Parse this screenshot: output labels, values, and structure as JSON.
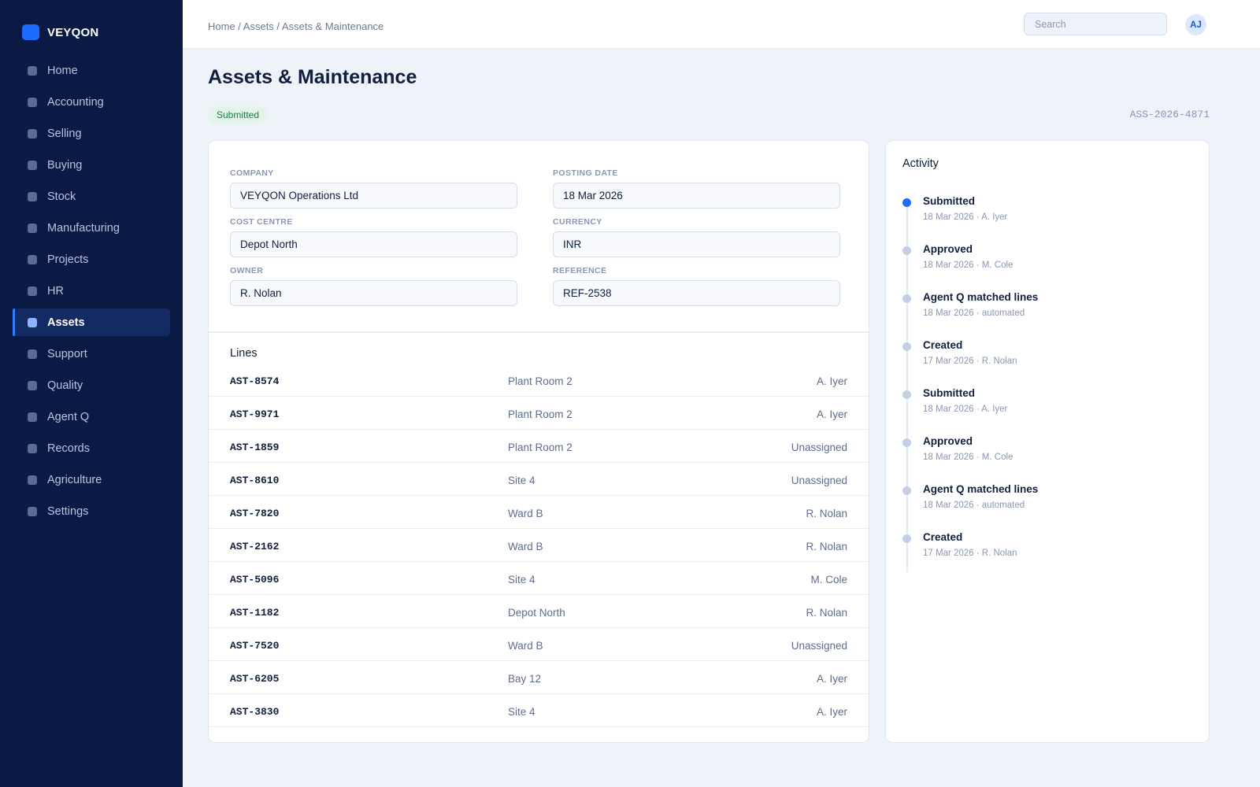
{
  "app": {
    "brand": "VEYQON"
  },
  "sidebar": {
    "items": [
      {
        "label": "Home",
        "active": false
      },
      {
        "label": "Accounting",
        "active": false
      },
      {
        "label": "Selling",
        "active": false
      },
      {
        "label": "Buying",
        "active": false
      },
      {
        "label": "Stock",
        "active": false
      },
      {
        "label": "Manufacturing",
        "active": false
      },
      {
        "label": "Projects",
        "active": false
      },
      {
        "label": "HR",
        "active": false
      },
      {
        "label": "Assets",
        "active": true
      },
      {
        "label": "Support",
        "active": false
      },
      {
        "label": "Quality",
        "active": false
      },
      {
        "label": "Agent Q",
        "active": false
      },
      {
        "label": "Records",
        "active": false
      },
      {
        "label": "Agriculture",
        "active": false
      },
      {
        "label": "Settings",
        "active": false
      }
    ]
  },
  "topbar": {
    "breadcrumb": "Home / Assets / Assets & Maintenance",
    "search_placeholder": "Search",
    "avatar_initials": "AJ"
  },
  "page": {
    "title": "Assets & Maintenance",
    "status": "Submitted",
    "doc_id": "ASS-2026-4871"
  },
  "form": {
    "fields": [
      {
        "key": "company",
        "label": "COMPANY",
        "value": "VEYQON Operations Ltd"
      },
      {
        "key": "posting-date",
        "label": "POSTING DATE",
        "value": "18 Mar 2026"
      },
      {
        "key": "cost-centre",
        "label": "COST CENTRE",
        "value": "Depot North"
      },
      {
        "key": "currency",
        "label": "CURRENCY",
        "value": "INR"
      },
      {
        "key": "owner",
        "label": "OWNER",
        "value": "R. Nolan"
      },
      {
        "key": "reference",
        "label": "REFERENCE",
        "value": "REF-2538"
      }
    ]
  },
  "lines": {
    "title": "Lines",
    "rows": [
      {
        "code": "AST-8574",
        "location": "Plant Room 2",
        "owner": "A. Iyer"
      },
      {
        "code": "AST-9971",
        "location": "Plant Room 2",
        "owner": "A. Iyer"
      },
      {
        "code": "AST-1859",
        "location": "Plant Room 2",
        "owner": "Unassigned"
      },
      {
        "code": "AST-8610",
        "location": "Site 4",
        "owner": "Unassigned"
      },
      {
        "code": "AST-7820",
        "location": "Ward B",
        "owner": "R. Nolan"
      },
      {
        "code": "AST-2162",
        "location": "Ward B",
        "owner": "R. Nolan"
      },
      {
        "code": "AST-5096",
        "location": "Site 4",
        "owner": "M. Cole"
      },
      {
        "code": "AST-1182",
        "location": "Depot North",
        "owner": "R. Nolan"
      },
      {
        "code": "AST-7520",
        "location": "Ward B",
        "owner": "Unassigned"
      },
      {
        "code": "AST-6205",
        "location": "Bay 12",
        "owner": "A. Iyer"
      },
      {
        "code": "AST-3830",
        "location": "Site 4",
        "owner": "A. Iyer"
      }
    ]
  },
  "activity": {
    "title": "Activity",
    "items": [
      {
        "label": "Submitted",
        "meta": "18 Mar 2026 · A. Iyer",
        "current": true
      },
      {
        "label": "Approved",
        "meta": "18 Mar 2026 · M. Cole",
        "current": false
      },
      {
        "label": "Agent Q matched lines",
        "meta": "18 Mar 2026 · automated",
        "current": false
      },
      {
        "label": "Created",
        "meta": "17 Mar 2026 · R. Nolan",
        "current": false
      },
      {
        "label": "Submitted",
        "meta": "18 Mar 2026 · A. Iyer",
        "current": false
      },
      {
        "label": "Approved",
        "meta": "18 Mar 2026 · M. Cole",
        "current": false
      },
      {
        "label": "Agent Q matched lines",
        "meta": "18 Mar 2026 · automated",
        "current": false
      },
      {
        "label": "Created",
        "meta": "17 Mar 2026 · R. Nolan",
        "current": false
      }
    ]
  },
  "colors": {
    "sidebar_bg": "#0b1a45",
    "accent": "#1c6cff",
    "status_bg": "#e3f4ea",
    "status_fg": "#1d7a43",
    "page_bg": "#eef2f9"
  }
}
